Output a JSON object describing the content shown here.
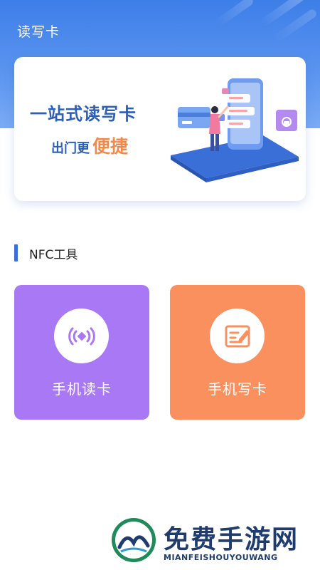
{
  "header": {
    "title": "读写卡"
  },
  "banner": {
    "line1": "一站式读写卡",
    "line2_prefix": "出门更",
    "line2_highlight": "便捷"
  },
  "section": {
    "title": "NFC工具"
  },
  "tiles": [
    {
      "label": "手机读卡",
      "icon": "nfc-signal-icon",
      "color": "#a878f5"
    },
    {
      "label": "手机写卡",
      "icon": "edit-note-icon",
      "color": "#f9905e"
    }
  ],
  "watermark": {
    "title": "免费手游网",
    "subtitle": "MIANFEISHOUYOUWANG"
  },
  "colors": {
    "header_blue": "#3d7ee8",
    "banner_text": "#2b5fb8",
    "highlight_orange": "#f08a4b",
    "accent_bar": "#3a6fd6"
  }
}
